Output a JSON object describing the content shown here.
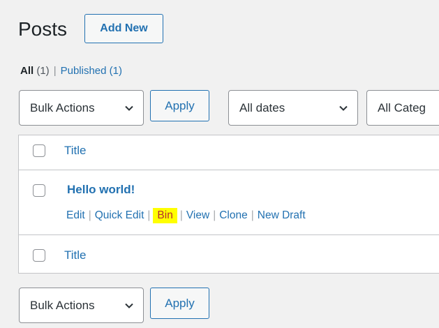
{
  "header": {
    "title": "Posts",
    "add_new_label": "Add New"
  },
  "filters": {
    "all_label": "All",
    "all_count": "(1)",
    "separator": "|",
    "published_label": "Published",
    "published_count": "(1)"
  },
  "tablenav_top": {
    "bulk_actions_value": "Bulk Actions",
    "apply_label": "Apply",
    "dates_value": "All dates",
    "categories_value": "All Categ"
  },
  "table": {
    "header_title": "Title",
    "footer_title": "Title",
    "rows": [
      {
        "title": "Hello world!",
        "actions": {
          "edit": "Edit",
          "quick_edit": "Quick Edit",
          "bin": "Bin",
          "view": "View",
          "clone": "Clone",
          "new_draft": "New Draft"
        }
      }
    ]
  },
  "tablenav_bottom": {
    "bulk_actions_value": "Bulk Actions",
    "apply_label": "Apply"
  },
  "colors": {
    "link": "#2271b1",
    "trash": "#b32d2e",
    "highlight": "#ffff00",
    "background": "#f1f1f1"
  },
  "icons": {
    "select_arrow": "chevron-down-icon"
  }
}
